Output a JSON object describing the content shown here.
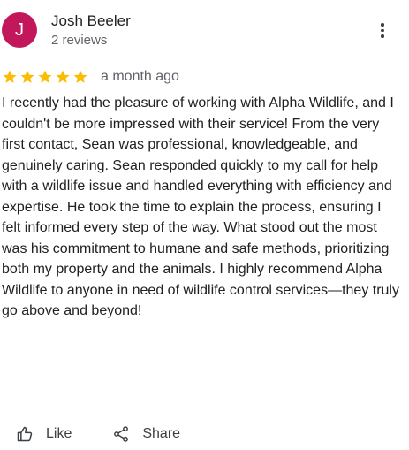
{
  "reviewer": {
    "initial": "J",
    "avatar_color": "#c2185b",
    "name": "Josh Beeler",
    "review_count": "2 reviews"
  },
  "menu_icon": "more-vert-icon",
  "rating": {
    "stars": 5,
    "max": 5,
    "star_color": "#fbbc04",
    "date": "a month ago"
  },
  "review_text": "I recently had the pleasure of working with Alpha Wildlife, and I couldn't be more impressed with their service! From the very first contact, Sean was professional, knowledgeable, and genuinely caring. Sean responded quickly to my call for help with a wildlife issue and handled everything with efficiency and expertise. He took the time to explain the process, ensuring I felt informed every step of the way. What stood out the most was his commitment to humane and safe methods, prioritizing both my property and the animals. I highly recommend Alpha Wildlife to anyone in need of wildlife control services—they truly go above and beyond!",
  "actions": {
    "like_label": "Like",
    "like_icon": "thumb-up-icon",
    "share_label": "Share",
    "share_icon": "share-icon"
  }
}
